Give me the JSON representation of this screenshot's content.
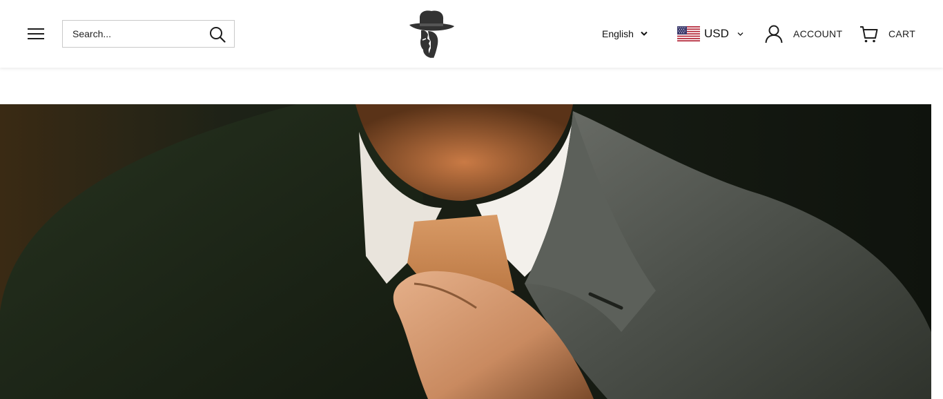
{
  "header": {
    "menu_icon": "hamburger-menu-icon",
    "search": {
      "placeholder": "Search...",
      "value": "",
      "icon": "search-icon"
    },
    "logo": {
      "icon": "fedora-hat-man-logo"
    },
    "language": {
      "selected": "English",
      "icon": "chevron-down-icon"
    },
    "currency": {
      "flag": "us-flag-icon",
      "selected": "USD",
      "icon": "chevron-down-icon"
    },
    "account": {
      "label": "ACCOUNT",
      "icon": "user-icon"
    },
    "cart": {
      "label": "CART",
      "icon": "cart-icon"
    }
  },
  "hero": {
    "image": "man-in-suit-adjusting-tie-photo"
  },
  "colors": {
    "text": "#1c1c1c",
    "border": "#c9c9c9",
    "hero_bg": "#1b1f17"
  }
}
